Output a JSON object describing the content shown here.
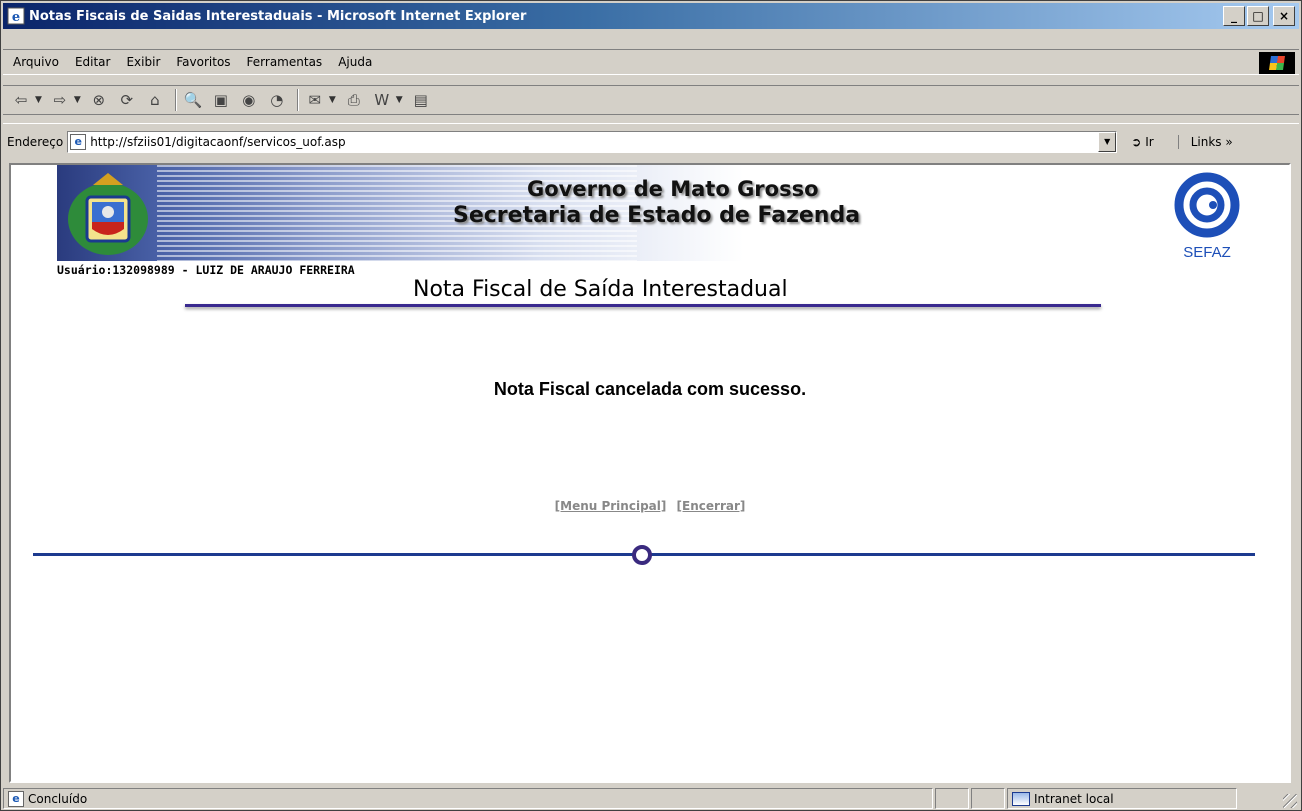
{
  "window": {
    "title": "Notas Fiscais de Saidas Interestaduais - Microsoft Internet Explorer",
    "buttons": {
      "minimize": "_",
      "maximize": "□",
      "close": "×"
    }
  },
  "menu": {
    "items": [
      {
        "label": "Arquivo"
      },
      {
        "label": "Editar"
      },
      {
        "label": "Exibir"
      },
      {
        "label": "Favoritos"
      },
      {
        "label": "Ferramentas"
      },
      {
        "label": "Ajuda"
      }
    ]
  },
  "toolbar": {
    "back": "⇦",
    "forward": "⇨",
    "stop": "⊗",
    "refresh": "⟳",
    "home": "⌂",
    "search": "🔍",
    "favorites": "▣",
    "media": "◉",
    "history": "◔",
    "mail": "✉",
    "print": "⎙",
    "edit": "W",
    "discuss": "▤"
  },
  "address": {
    "label": "Endereço",
    "url": "http://sfziis01/digitacaonf/servicos_uof.asp",
    "go_label": "Ir",
    "links_label": "Links »"
  },
  "page": {
    "banner_line1": "Governo de Mato Grosso",
    "banner_line2": "Secretaria de Estado de Fazenda",
    "logo_text": "SEFAZ",
    "user": "Usuário:132098989 - LUIZ DE ARAUJO FERREIRA",
    "title": "Nota Fiscal de Saída Interestadual",
    "message": "Nota Fiscal cancelada com sucesso.",
    "link_menu": "[Menu Principal]",
    "link_close": "[Encerrar]"
  },
  "status": {
    "text": "Concluído",
    "zone": "Intranet local"
  }
}
